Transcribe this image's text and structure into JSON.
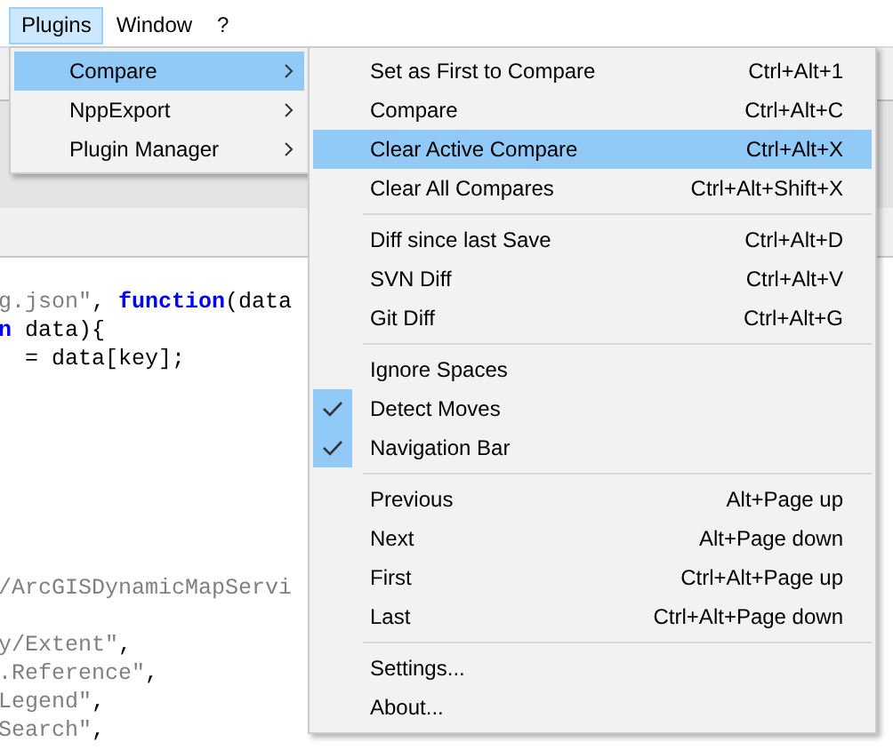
{
  "menubar": [
    {
      "label": "Plugins",
      "selected": true
    },
    {
      "label": "Window",
      "selected": false
    },
    {
      "label": "?",
      "selected": false
    }
  ],
  "plugins_menu": {
    "items": [
      {
        "label": "Compare",
        "selected": true,
        "has_submenu": true
      },
      {
        "label": "NppExport",
        "selected": false,
        "has_submenu": true
      },
      {
        "label": "Plugin Manager",
        "selected": false,
        "has_submenu": true
      }
    ]
  },
  "compare_menu": {
    "items": [
      {
        "kind": "item",
        "label": "Set as First to Compare",
        "shortcut": "Ctrl+Alt+1",
        "selected": false,
        "checked": false
      },
      {
        "kind": "item",
        "label": "Compare",
        "shortcut": "Ctrl+Alt+C",
        "selected": false,
        "checked": false
      },
      {
        "kind": "item",
        "label": "Clear Active Compare",
        "shortcut": "Ctrl+Alt+X",
        "selected": true,
        "checked": false
      },
      {
        "kind": "item",
        "label": "Clear All Compares",
        "shortcut": "Ctrl+Alt+Shift+X",
        "selected": false,
        "checked": false
      },
      {
        "kind": "separator"
      },
      {
        "kind": "item",
        "label": "Diff since last Save",
        "shortcut": "Ctrl+Alt+D",
        "selected": false,
        "checked": false
      },
      {
        "kind": "item",
        "label": "SVN Diff",
        "shortcut": "Ctrl+Alt+V",
        "selected": false,
        "checked": false
      },
      {
        "kind": "item",
        "label": "Git Diff",
        "shortcut": "Ctrl+Alt+G",
        "selected": false,
        "checked": false
      },
      {
        "kind": "separator"
      },
      {
        "kind": "item",
        "label": "Ignore Spaces",
        "selected": false,
        "checked": false
      },
      {
        "kind": "item",
        "label": "Detect Moves",
        "selected": false,
        "checked": true
      },
      {
        "kind": "item",
        "label": "Navigation Bar",
        "selected": false,
        "checked": true
      },
      {
        "kind": "separator"
      },
      {
        "kind": "item",
        "label": "Previous",
        "shortcut": "Alt+Page up",
        "selected": false,
        "checked": false
      },
      {
        "kind": "item",
        "label": "Next",
        "shortcut": "Alt+Page down",
        "selected": false,
        "checked": false
      },
      {
        "kind": "item",
        "label": "First",
        "shortcut": "Ctrl+Alt+Page up",
        "selected": false,
        "checked": false
      },
      {
        "kind": "item",
        "label": "Last",
        "shortcut": "Ctrl+Alt+Page down",
        "selected": false,
        "checked": false
      },
      {
        "kind": "separator"
      },
      {
        "kind": "item",
        "label": "Settings...",
        "selected": false,
        "checked": false
      },
      {
        "kind": "item",
        "label": "About...",
        "selected": false,
        "checked": false
      }
    ]
  },
  "editor": {
    "blocks": [
      {
        "lines": [
          [
            {
              "kind": "string",
              "text": "g.json\""
            },
            {
              "kind": "plain",
              "text": ", "
            },
            {
              "kind": "keyword",
              "text": "function"
            },
            {
              "kind": "plain",
              "text": "(data"
            }
          ],
          [
            {
              "kind": "keyword",
              "text": "n"
            },
            {
              "kind": "plain",
              "text": " data){"
            }
          ],
          [
            {
              "kind": "plain",
              "text": "  = data[key];"
            }
          ]
        ]
      },
      {
        "lines": [
          [
            {
              "kind": "string",
              "text": "/ArcGISDynamicMapServi"
            }
          ]
        ]
      },
      {
        "lines": [
          [
            {
              "kind": "string",
              "text": "y/Extent\""
            },
            {
              "kind": "plain",
              "text": ","
            }
          ],
          [
            {
              "kind": "string",
              "text": ".Reference\""
            },
            {
              "kind": "plain",
              "text": ","
            }
          ],
          [
            {
              "kind": "string",
              "text": "Legend\""
            },
            {
              "kind": "plain",
              "text": ","
            }
          ],
          [
            {
              "kind": "string",
              "text": "Search\""
            },
            {
              "kind": "plain",
              "text": ","
            }
          ]
        ]
      }
    ]
  }
}
